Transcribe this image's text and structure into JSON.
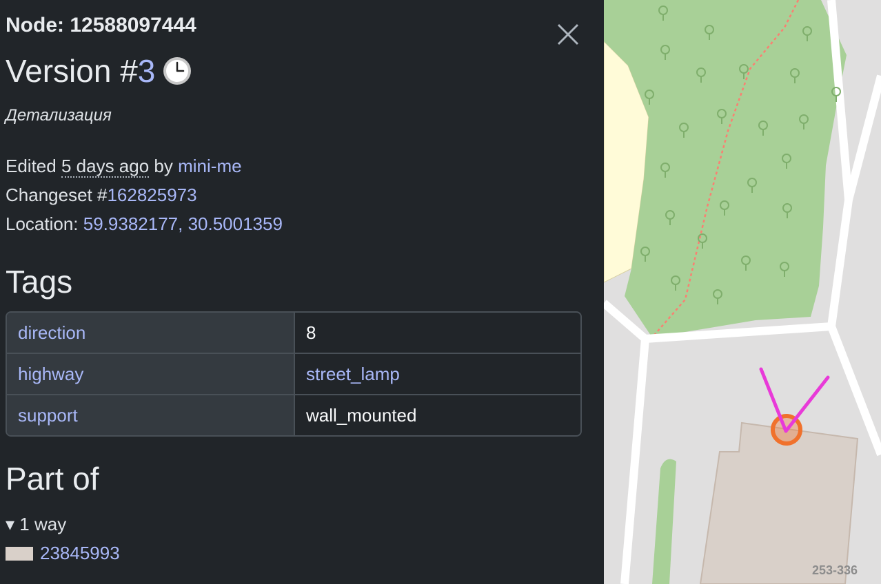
{
  "node": {
    "title": "Node: 12588097444"
  },
  "version": {
    "prefix": "Version #",
    "number": "3"
  },
  "comment": "Детализация",
  "edited": {
    "prefix": "Edited",
    "time": "5 days ago",
    "by": "by",
    "user": "mini-me"
  },
  "changeset": {
    "prefix": "Changeset #",
    "id": "162825973"
  },
  "location": {
    "prefix": "Location:",
    "coords": "59.9382177, 30.5001359"
  },
  "tags": {
    "heading": "Tags",
    "rows": [
      {
        "key": "direction",
        "value": "8"
      },
      {
        "key": "highway",
        "value": "street_lamp"
      },
      {
        "key": "support",
        "value": "wall_mounted"
      }
    ]
  },
  "part_of": {
    "heading": "Part of",
    "toggle": "▾ 1 way",
    "way_id": "23845993"
  },
  "map": {
    "label": "253-336"
  },
  "colors": {
    "panel_bg": "#212529",
    "link": "#a9b8f8",
    "marker": "#f0712c",
    "arrow": "#e83ad8",
    "park": "#a8d097"
  }
}
